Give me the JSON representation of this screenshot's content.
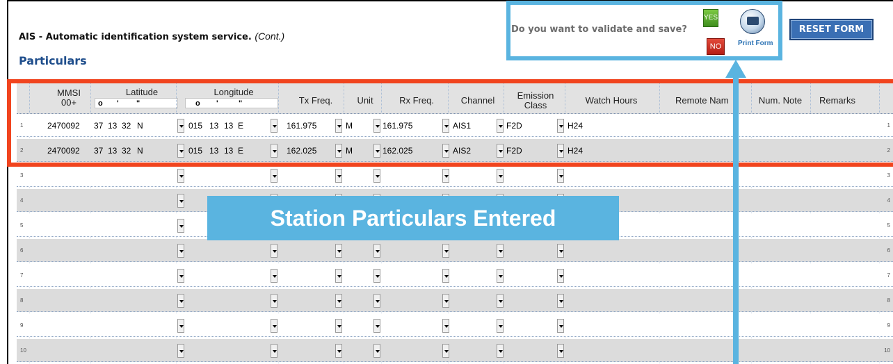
{
  "header": {
    "title": "AIS - Automatic identification system service.",
    "title_suffix": "(Cont.)",
    "section": "Particulars"
  },
  "validate": {
    "question": "Do you want to validate and save?",
    "yes_label": "YES",
    "no_label": "NO",
    "print_label": "Print Form"
  },
  "reset_label": "RESET FORM",
  "grid": {
    "columns": {
      "mmsi": "MMSI\n00+",
      "latitude": "Latitude",
      "longitude": "Longitude",
      "tx_freq": "Tx Freq.",
      "unit": "Unit",
      "rx_freq": "Rx Freq.",
      "channel": "Channel",
      "emission": "Emission\nClass",
      "watch": "Watch Hours",
      "remote": "Remote Nam",
      "num_note": "Num. Note",
      "remarks": "Remarks"
    },
    "dms_symbols": [
      "o",
      "'",
      "\""
    ],
    "rows": [
      {
        "n": "1",
        "mmsi": "2470092",
        "lat_d": "37",
        "lat_m": "13",
        "lat_s": "32",
        "lat_h": "N",
        "lon_d": "015",
        "lon_m": "13",
        "lon_s": "13",
        "lon_h": "E",
        "tx": "161.975",
        "unit": "M",
        "rx": "161.975",
        "channel": "AIS1",
        "emission": "F2D",
        "watch": "H24"
      },
      {
        "n": "2",
        "mmsi": "2470092",
        "lat_d": "37",
        "lat_m": "13",
        "lat_s": "32",
        "lat_h": "N",
        "lon_d": "015",
        "lon_m": "13",
        "lon_s": "13",
        "lon_h": "E",
        "tx": "162.025",
        "unit": "M",
        "rx": "162.025",
        "channel": "AIS2",
        "emission": "F2D",
        "watch": "H24"
      },
      {
        "n": "3"
      },
      {
        "n": "4"
      },
      {
        "n": "5"
      },
      {
        "n": "6"
      },
      {
        "n": "7"
      },
      {
        "n": "8"
      },
      {
        "n": "9"
      },
      {
        "n": "10"
      }
    ]
  },
  "callout": "Station Particulars Entered",
  "colors": {
    "highlight_red": "#f1441e",
    "callout_blue": "#5ab4e0",
    "reset_blue": "#3a6fb4",
    "section_blue": "#1f4e8c"
  }
}
